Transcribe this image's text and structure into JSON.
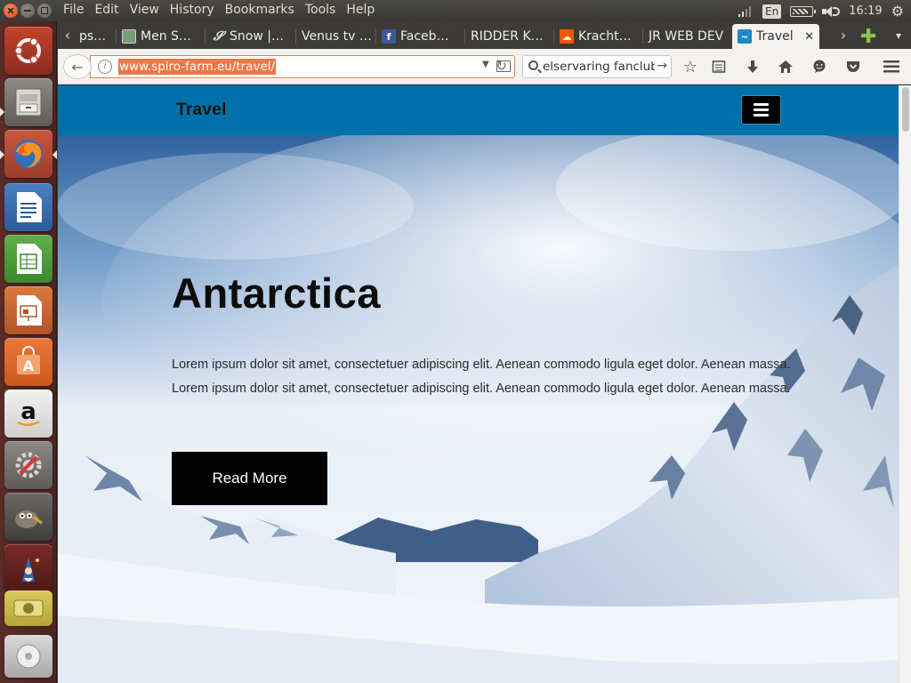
{
  "menubar": {
    "items": [
      "File",
      "Edit",
      "View",
      "History",
      "Bookmarks",
      "Tools",
      "Help"
    ],
    "indicators": {
      "language": "En",
      "clock": "16:19"
    }
  },
  "launcher": {
    "apps": [
      "Ubuntu Dash",
      "Files",
      "Firefox Web Browser",
      "LibreOffice Writer",
      "LibreOffice Calc",
      "LibreOffice Impress",
      "Ubuntu Software",
      "Amazon",
      "System Settings",
      "GIMP",
      "Stellarium",
      "Disk",
      "Trash"
    ]
  },
  "tabs": [
    {
      "title": "ps…",
      "favicon": "cut-off-favicon"
    },
    {
      "title": "Men S…",
      "favicon": "image-favicon"
    },
    {
      "title": "Snow |…",
      "favicon": "snow-favicon"
    },
    {
      "title": "Venus tv …",
      "favicon": "none"
    },
    {
      "title": "Faceb…",
      "favicon": "facebook-favicon"
    },
    {
      "title": "RIDDER K…",
      "favicon": "none"
    },
    {
      "title": "Kracht…",
      "favicon": "soundcloud-favicon"
    },
    {
      "title": "JR WEB DEV",
      "favicon": "none"
    },
    {
      "title": "Travel",
      "favicon": "travel-favicon",
      "active": true
    }
  ],
  "toolbar": {
    "url": "www.spiro-farm.eu/travel/",
    "search": "elservaring fanclub"
  },
  "page": {
    "site_title": "Travel",
    "hero_title": "Antarctica",
    "hero_text": "Lorem ipsum dolor sit amet, consectetuer adipiscing elit. Aenean commodo ligula eget dolor. Aenean massa. Lorem ipsum dolor sit amet, consectetuer adipiscing elit. Aenean commodo ligula eget dolor. Aenean massa.",
    "button_label": "Read More"
  },
  "colors": {
    "header_bg": "#0070aa",
    "button_bg": "#000000",
    "url_highlight": "#f07746",
    "launcher_bg": "#5a2c28"
  }
}
